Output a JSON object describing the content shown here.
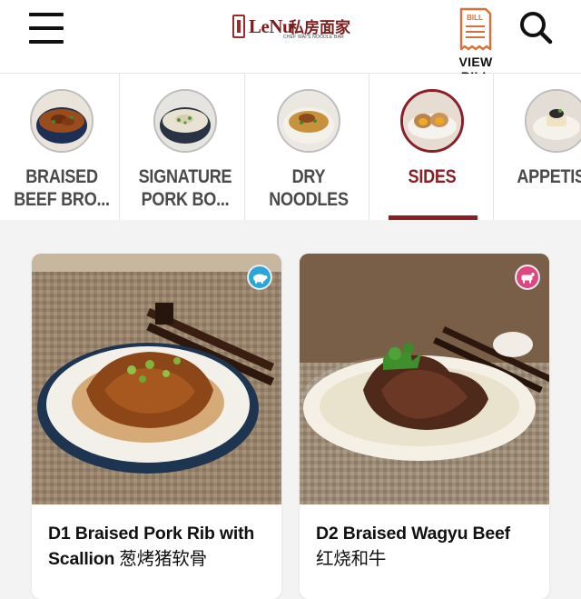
{
  "header": {
    "logo": {
      "wordmark": "LeNu",
      "chinese_name": "私房面家",
      "subtitle": "CHEF WAI'S NOODLE BAR"
    },
    "menu_icon": "hamburger-menu-icon",
    "bill": {
      "label": "VIEW BILL",
      "icon": "bill-receipt-icon",
      "icon_text": "BILL"
    },
    "search_icon": "search-icon"
  },
  "categories": [
    {
      "label": "BRAISED\nBEEF BRO...",
      "active": false
    },
    {
      "label": "SIGNATURE\nPORK BO...",
      "active": false
    },
    {
      "label": "DRY\nNOODLES",
      "active": false
    },
    {
      "label": "SIDES",
      "active": true
    },
    {
      "label": "APPETISE",
      "active": false
    }
  ],
  "products": [
    {
      "title": "D1 Braised Pork Rib with Scallion",
      "title_cn": "葱烤猪软骨",
      "badge_icon": "pig-icon",
      "badge_color": "#2aa7d8"
    },
    {
      "title": "D2 Braised Wagyu Beef",
      "title_cn": "红烧和牛",
      "badge_icon": "cow-icon",
      "badge_color": "#e0467f"
    }
  ],
  "colors": {
    "accent": "#8b1f26",
    "bill_icon": "#d9703a",
    "background": "#f3f3f3"
  }
}
